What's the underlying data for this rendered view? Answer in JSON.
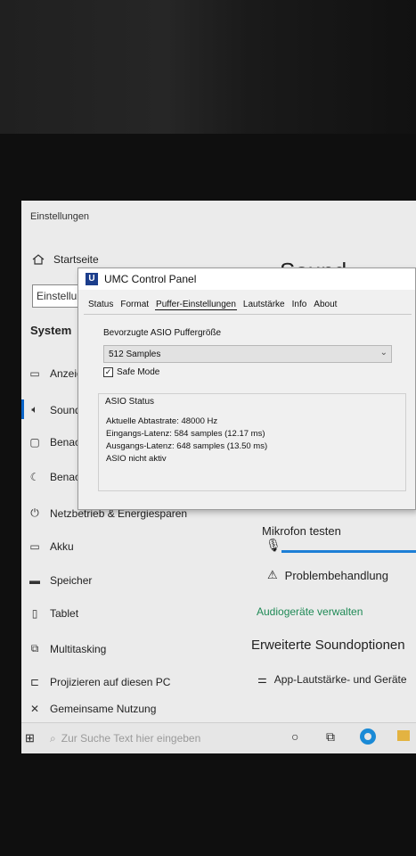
{
  "settings": {
    "window_title": "Einstellungen",
    "home_label": "Startseite",
    "search_placeholder": "Einstellun",
    "section_label": "System",
    "nav_items": [
      {
        "label": "Anzeige",
        "icon": "monitor-icon"
      },
      {
        "label": "Sound",
        "icon": "speaker-icon"
      },
      {
        "label": "Benachrichtigungen",
        "icon": "notification-icon"
      },
      {
        "label": "Benachrichtigungsassistent",
        "icon": "moon-icon"
      },
      {
        "label": "Netzbetrieb & Energiesparen",
        "icon": "power-icon"
      },
      {
        "label": "Akku",
        "icon": "battery-icon"
      },
      {
        "label": "Speicher",
        "icon": "storage-icon"
      },
      {
        "label": "Tablet",
        "icon": "tablet-icon"
      },
      {
        "label": "Multitasking",
        "icon": "multitasking-icon"
      },
      {
        "label": "Projizieren auf diesen PC",
        "icon": "project-icon"
      },
      {
        "label": "Gemeinsame Nutzung",
        "icon": "share-icon"
      }
    ],
    "page_heading": "Sound",
    "mic_test_label": "Mikrofon testen",
    "troubleshoot_label": "Problembehandlung",
    "manage_devices_link": "Audiogeräte verwalten",
    "advanced_heading": "Erweiterte Soundoptionen",
    "app_volume_label": "App-Lautstärke- und Geräte"
  },
  "taskbar": {
    "search_placeholder": "Zur Suche Text hier eingeben"
  },
  "dialog": {
    "title": "UMC Control Panel",
    "tabs": [
      "Status",
      "Format",
      "Puffer-Einstellungen",
      "Lautstärke",
      "Info",
      "About"
    ],
    "active_tab": "Puffer-Einstellungen",
    "buffer_label": "Bevorzugte ASIO Puffergröße",
    "buffer_value": "512 Samples",
    "safe_mode_label": "Safe Mode",
    "safe_mode_checked": true,
    "status_group_title": "ASIO Status",
    "status_lines": {
      "sample_rate": "Aktuelle Abtastrate: 48000 Hz",
      "input_latency": "Eingangs-Latenz: 584 samples (12.17 ms)",
      "output_latency": "Ausgangs-Latenz: 648 samples (13.50 ms)",
      "asio_state": "ASIO nicht aktiv"
    }
  }
}
